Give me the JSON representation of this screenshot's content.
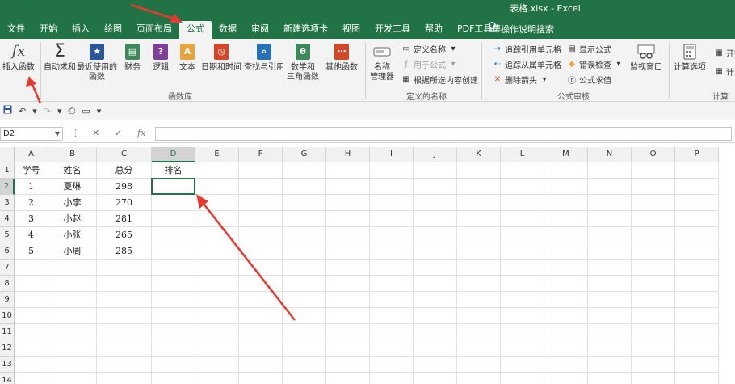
{
  "window": {
    "title": "表格.xlsx  -  Excel"
  },
  "tabs": [
    "文件",
    "开始",
    "插入",
    "绘图",
    "页面布局",
    "公式",
    "数据",
    "审阅",
    "新建选项卡",
    "视图",
    "开发工具",
    "帮助",
    "PDF工具集"
  ],
  "active_tab": "公式",
  "tell_me": "操作说明搜索",
  "ribbon": {
    "insert_function": "插入函数",
    "autosum": "自动求和",
    "recent_1": "最近使用的",
    "recent_2": "函数",
    "financial": "财务",
    "logical": "逻辑",
    "text": "文本",
    "datetime": "日期和时间",
    "lookup": "查找与引用",
    "math_1": "数学和",
    "math_2": "三角函数",
    "more": "其他函数",
    "group_library": "函数库",
    "name_manager_1": "名称",
    "name_manager_2": "管理器",
    "define_name": "定义名称",
    "use_in_formula": "用于公式",
    "create_from_selection": "根据所选内容创建",
    "group_names": "定义的名称",
    "trace_precedents": "追踪引用单元格",
    "trace_dependents": "追踪从属单元格",
    "remove_arrows": "删除箭头",
    "show_formulas": "显示公式",
    "error_checking": "错误检查",
    "evaluate_formula": "公式求值",
    "watch_window": "监视窗口",
    "group_audit": "公式审核",
    "calc_options": "计算选项",
    "calc_now_partial": "开始",
    "calc_sheet_partial": "计算",
    "group_calc": "计算"
  },
  "formula_bar": {
    "name_box": "D2",
    "value": ""
  },
  "columns": [
    "A",
    "B",
    "C",
    "D",
    "E",
    "F",
    "G",
    "H",
    "I",
    "J",
    "K",
    "L",
    "M",
    "N",
    "O",
    "P"
  ],
  "rows": [
    "1",
    "2",
    "3",
    "4",
    "5",
    "6",
    "7",
    "8",
    "9",
    "10",
    "11",
    "12",
    "13",
    "14"
  ],
  "selected_cell": "D2",
  "sheet": {
    "headers": [
      "学号",
      "姓名",
      "总分",
      "排名"
    ],
    "records": [
      [
        "1",
        "夏琳",
        "298",
        ""
      ],
      [
        "2",
        "小李",
        "270",
        ""
      ],
      [
        "3",
        "小赵",
        "281",
        ""
      ],
      [
        "4",
        "小张",
        "265",
        ""
      ],
      [
        "5",
        "小周",
        "285",
        ""
      ]
    ]
  },
  "colors": {
    "excel_green": "#217346",
    "annotation_red": "#e8392f"
  },
  "icons": [
    "fx-icon",
    "sigma-icon",
    "star-icon",
    "financial-icon",
    "question-icon",
    "text-a-icon",
    "calendar-icon",
    "search-icon",
    "theta-icon",
    "more-functions-icon",
    "name-manager-icon",
    "lightbulb-icon",
    "save-icon",
    "undo-icon",
    "redo-icon",
    "watch-window-icon",
    "calculator-icon"
  ]
}
